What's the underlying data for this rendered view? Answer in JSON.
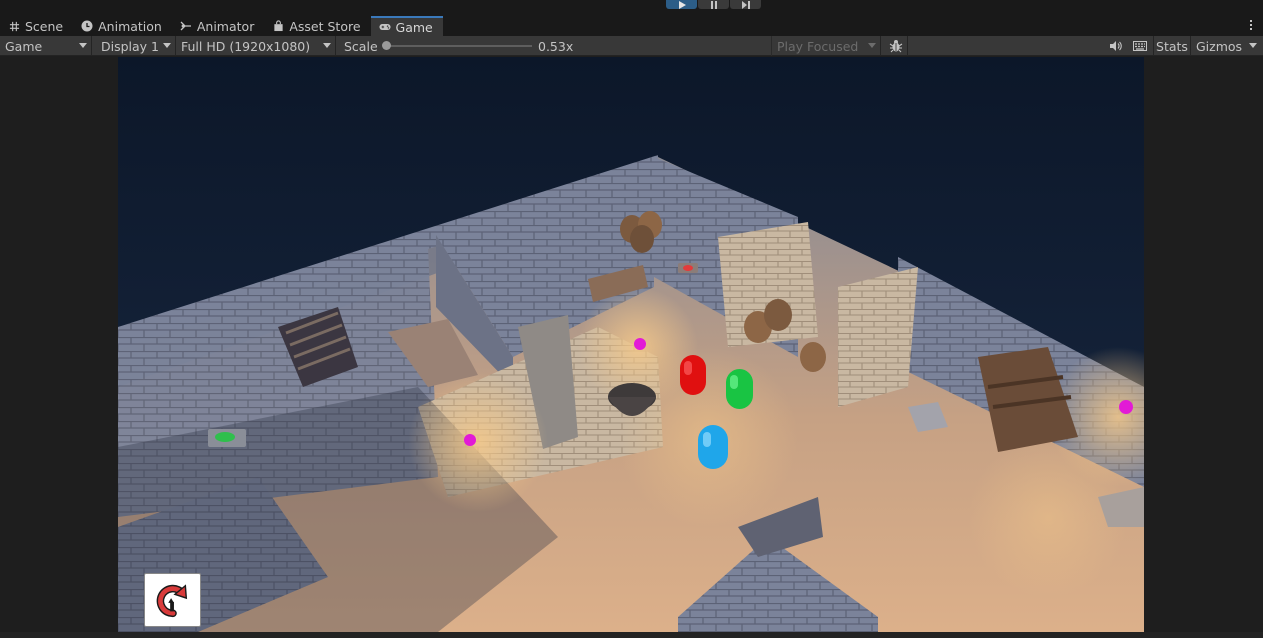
{
  "play_controls": [
    {
      "name": "play",
      "icon": "play-icon",
      "active": true
    },
    {
      "name": "pause",
      "icon": "pause-icon",
      "active": false
    },
    {
      "name": "step",
      "icon": "step-icon",
      "active": false
    }
  ],
  "tabs": [
    {
      "label": "Scene",
      "icon": "grid-icon"
    },
    {
      "label": "Animation",
      "icon": "clock-icon"
    },
    {
      "label": "Animator",
      "icon": "animator-icon"
    },
    {
      "label": "Asset Store",
      "icon": "bag-icon"
    },
    {
      "label": "Game",
      "icon": "gamepad-icon",
      "active": true
    }
  ],
  "toolbar": {
    "view_mode": "Game",
    "display": "Display 1",
    "resolution": "Full HD (1920x1080)",
    "scale_label": "Scale",
    "scale_value": "0.53x",
    "scale_fraction": 0.0,
    "play_mode": "Play Focused",
    "stats_label": "Stats",
    "gizmos_label": "Gizmos"
  },
  "colors": {
    "accent": "#3a79bb",
    "play_active": "#2c5d87",
    "panel": "#383838",
    "background": "#191919",
    "restart_arrow": "#d83a3a"
  },
  "game_view": {
    "restart_icon": "restart-arrow-icon"
  }
}
